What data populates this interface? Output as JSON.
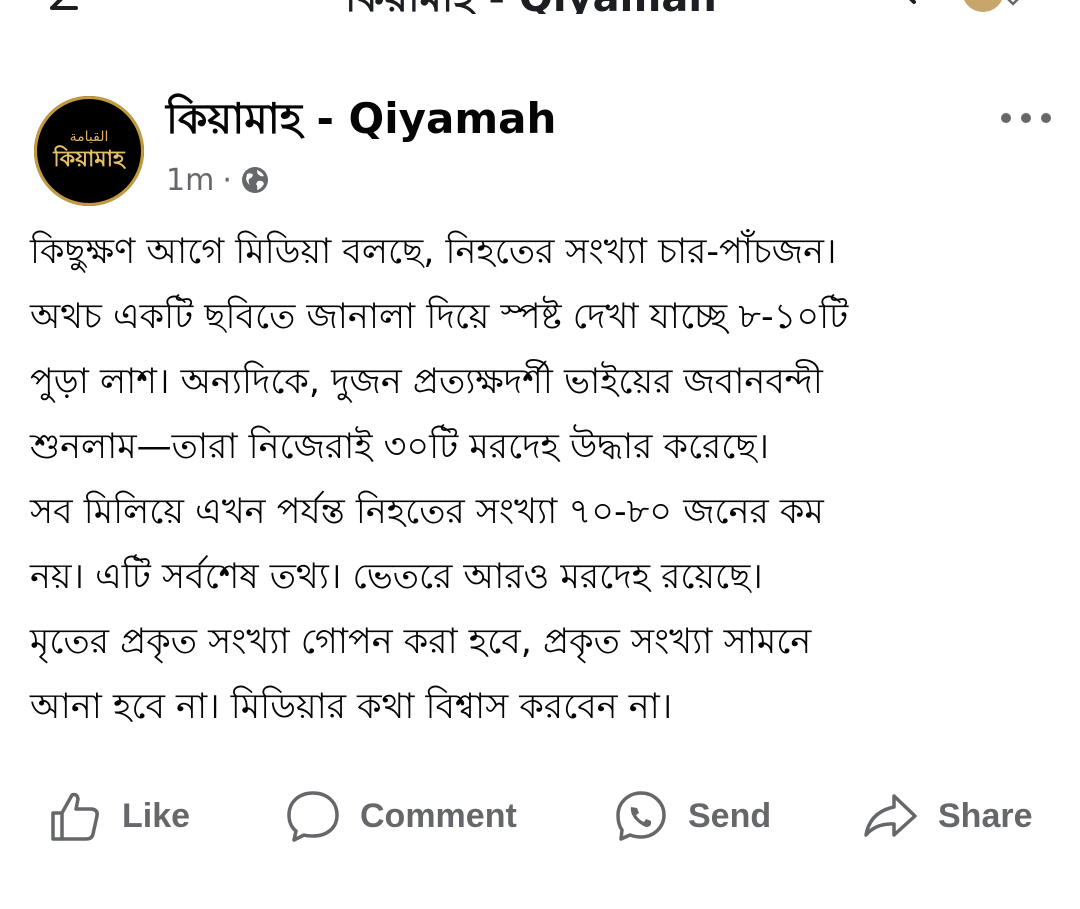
{
  "topbar": {
    "title": "কিয়ামাহ - Qiyamah",
    "back_icon": "back-arrow-icon",
    "search_icon": "search-icon"
  },
  "post": {
    "avatar": {
      "arabic_text": "القيامة",
      "bengali_text": "কিয়ামাহ",
      "colors": {
        "background": "#000000",
        "ring": "#c49a3c",
        "text": "#e3bf68"
      }
    },
    "page_name": "কিয়ামাহ - Qiyamah",
    "timestamp": "1m",
    "separator": "·",
    "audience_icon": "globe-icon",
    "more_icon": "more-options-icon",
    "text": "কিছুক্ষণ আগে মিডিয়া বলছে, নিহতের সংখ্যা চার-পাঁচজন।\nঅথচ একটি ছবিতে জানালা দিয়ে স্পষ্ট দেখা যাচ্ছে ৮-১০টি\nপুড়া লাশ। অন্যদিকে, দুজন প্রত্যক্ষদর্শী ভাইয়ের জবানবন্দী\nশুনলাম—তারা নিজেরাই ৩০টি মরদেহ উদ্ধার করেছে।\nসব মিলিয়ে এখন পর্যন্ত নিহতের সংখ্যা ৭০-৮০ জনের কম\nনয়। এটি সর্বশেষ তথ্য। ভেতরে আরও মরদেহ রয়েছে।\nমৃতের প্রকৃত সংখ্যা গোপন করা হবে, প্রকৃত সংখ্যা সামনে\nআনা হবে না। মিডিয়ার কথা বিশ্বাস করবেন না।"
  },
  "actions": {
    "like": {
      "label": "Like",
      "icon": "thumbs-up-icon"
    },
    "comment": {
      "label": "Comment",
      "icon": "comment-bubble-icon"
    },
    "send": {
      "label": "Send",
      "icon": "messenger-icon"
    },
    "share": {
      "label": "Share",
      "icon": "share-arrow-icon"
    }
  },
  "colors": {
    "text_primary": "#050505",
    "text_secondary": "#65676b"
  }
}
